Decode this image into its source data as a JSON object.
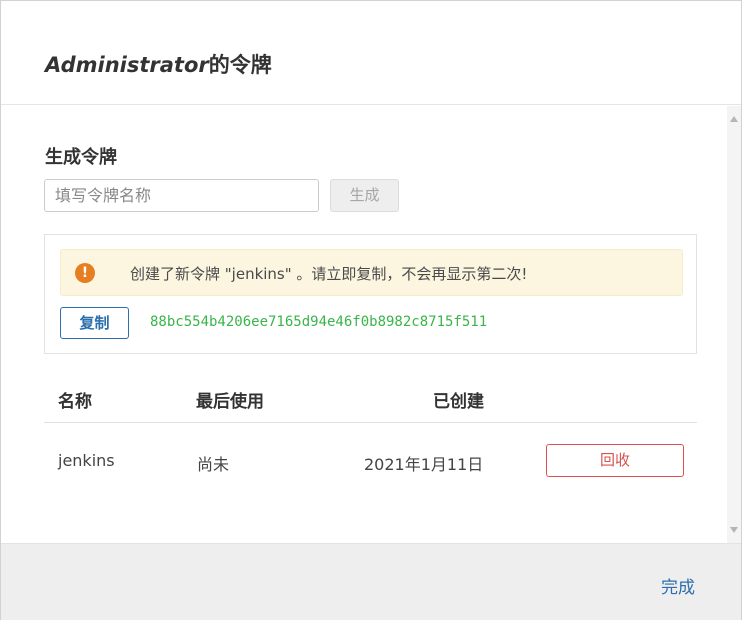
{
  "dialog": {
    "title_italic": "Administrator",
    "title_suffix": "的令牌"
  },
  "generate": {
    "section_title": "生成令牌",
    "input_placeholder": "填写令牌名称",
    "input_value": "",
    "button_label": "生成"
  },
  "new_token": {
    "alert_icon": "!",
    "alert_text": "创建了新令牌 \"jenkins\" 。请立即复制，不会再显示第二次!",
    "copy_label": "复制",
    "token_value": "88bc554b4206ee7165d94e46f0b8982c8715f511",
    "colors": {
      "alert_bg": "#fcf6e0",
      "icon": "#e67e22",
      "token": "#39b54a",
      "copy": "#2d6fad"
    }
  },
  "table": {
    "headers": [
      "名称",
      "最后使用",
      "已创建"
    ],
    "rows": [
      {
        "name": "jenkins",
        "last_used": "尚未",
        "created": "2021年1月11日",
        "action": "回收"
      }
    ]
  },
  "footer": {
    "done_label": "完成"
  }
}
